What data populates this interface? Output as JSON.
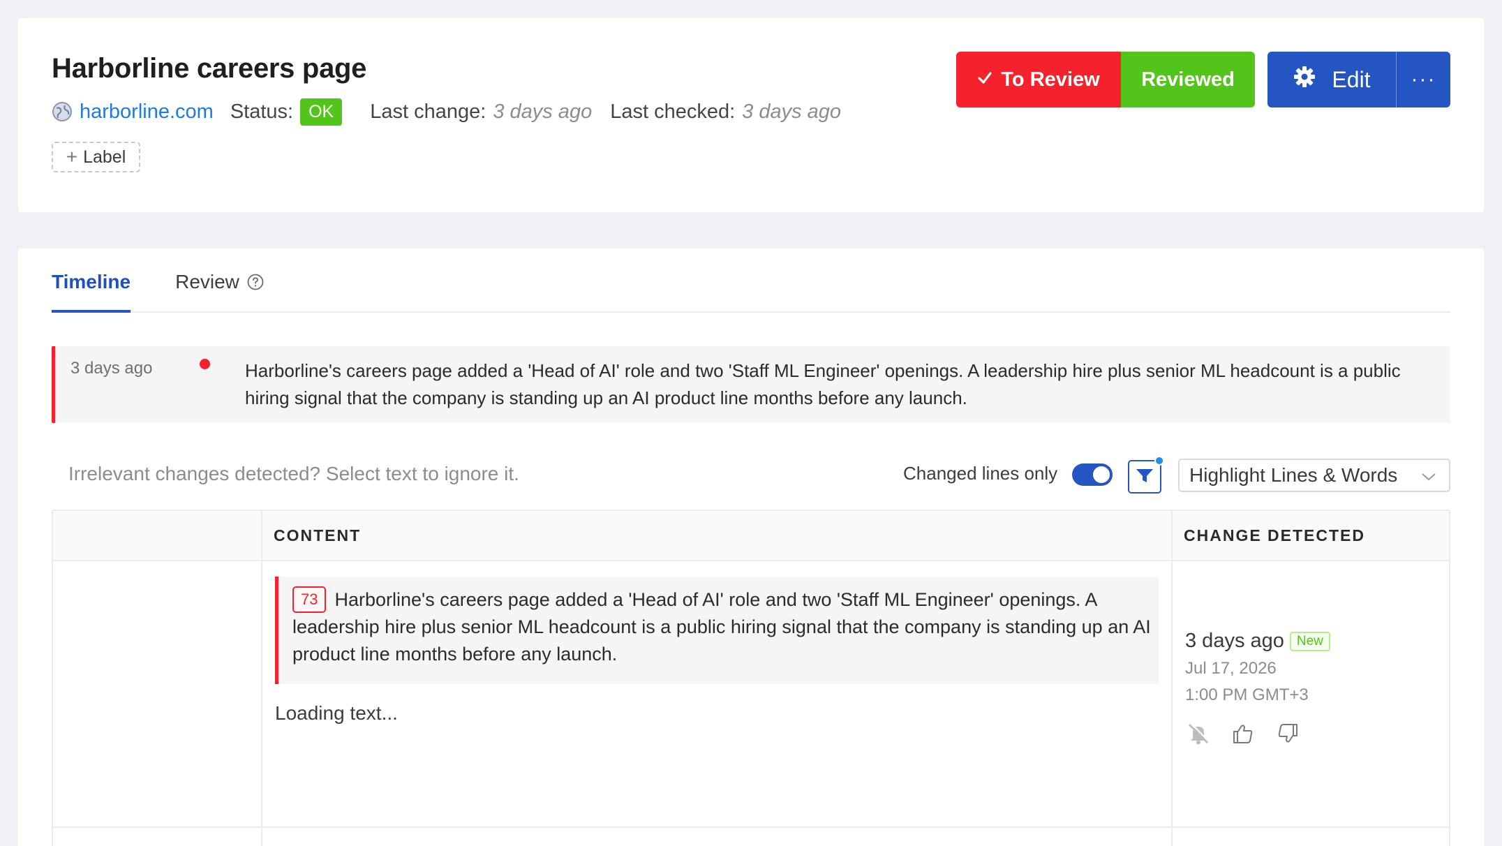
{
  "header": {
    "title": "Harborline careers page",
    "site": "harborline.com",
    "status_label": "Status:",
    "status_value": "OK",
    "last_change_label": "Last change:",
    "last_change_value": "3 days ago",
    "last_checked_label": "Last checked:",
    "last_checked_value": "3 days ago",
    "add_label": "Label",
    "to_review_label": "To Review",
    "reviewed_label": "Reviewed",
    "edit_label": "Edit",
    "more_label": "···"
  },
  "tabs": [
    {
      "label": "Timeline",
      "active": true
    },
    {
      "label": "Review",
      "active": false
    }
  ],
  "timeline": {
    "time": "3 days ago",
    "summary": "Harborline's careers page added a 'Head of AI' role and two 'Staff ML Engineer' openings. A leadership hire plus senior ML headcount is a public hiring signal that the company is standing up an AI product line months before any launch."
  },
  "toolbar": {
    "hint": "Irrelevant changes detected? Select text to ignore it.",
    "changed_lines_label": "Changed lines only",
    "changed_lines_on": true,
    "highlight_mode": "Highlight Lines & Words"
  },
  "table": {
    "headers": {
      "content": "CONTENT",
      "change": "CHANGE DETECTED"
    },
    "row": {
      "line_number": "73",
      "text": "Harborline's careers page added a 'Head of AI' role and two 'Staff ML Engineer' openings. A leadership hire plus senior ML headcount is a public hiring signal that the company is standing up an AI product line months before any launch.",
      "loading": "Loading text...",
      "detected_ago": "3 days ago",
      "new_badge": "New",
      "date": "Jul 17, 2026",
      "time": "1:00 PM GMT+3"
    }
  },
  "colors": {
    "accent": "#2455c3",
    "danger": "#f5222d",
    "success": "#52c41a",
    "link": "#1f7ae0"
  }
}
